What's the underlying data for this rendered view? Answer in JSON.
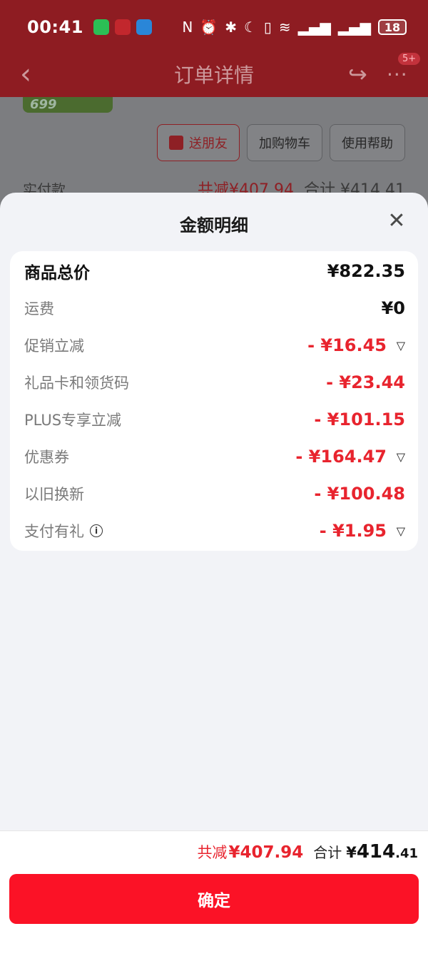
{
  "status_bar": {
    "time": "00:41",
    "battery": "18"
  },
  "nav": {
    "title": "订单详情",
    "badge": "5+"
  },
  "background": {
    "promo_price": "699",
    "actions": [
      "送朋友",
      "加购物车",
      "使用帮助"
    ],
    "pay_label": "实付款",
    "pay_deduct": "共减¥407.94",
    "pay_total": "合计 ¥414.41"
  },
  "sheet": {
    "title": "金额明细",
    "rows": [
      {
        "label": "商品总价",
        "value": "¥822.35"
      },
      {
        "label": "运费",
        "value": "¥0"
      },
      {
        "label": "促销立减",
        "value": "- ¥16.45"
      },
      {
        "label": "礼品卡和领货码",
        "value": "- ¥23.44"
      },
      {
        "label": "PLUS专享立减",
        "value": "- ¥101.15"
      },
      {
        "label": "优惠券",
        "value": "- ¥164.47"
      },
      {
        "label": "以旧换新",
        "value": "- ¥100.48"
      },
      {
        "label": "支付有礼",
        "value": "- ¥1.95"
      }
    ]
  },
  "footer": {
    "deduct_label": "共减",
    "deduct_value": "¥407.94",
    "total_label": "合计",
    "total_currency": "¥",
    "total_int": "414",
    "total_dec": ".41",
    "confirm_label": "确定"
  },
  "colors": {
    "accent_red": "#fb1226",
    "discount_red": "#e8242e"
  }
}
